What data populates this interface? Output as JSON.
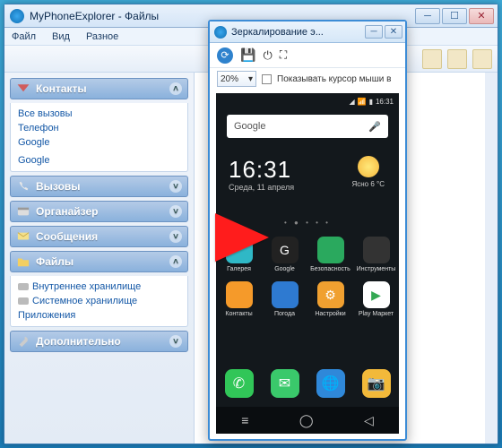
{
  "main": {
    "title": "MyPhoneExplorer -  Файлы",
    "menu": [
      "Файл",
      "Вид",
      "Разное"
    ]
  },
  "sidebar": {
    "contacts": {
      "title": "Контакты",
      "items": [
        "Все вызовы",
        "Телефон",
        "Google",
        " ",
        "Google"
      ]
    },
    "calls": {
      "title": "Вызовы"
    },
    "organizer": {
      "title": "Органайзер"
    },
    "messages": {
      "title": "Сообщения"
    },
    "files": {
      "title": "Файлы",
      "items": [
        "Внутреннее хранилище",
        "Системное хранилище",
        "Приложения"
      ]
    },
    "extra": {
      "title": "Дополнительно"
    }
  },
  "popup": {
    "title": "Зеркалирование э...",
    "zoom": "20%",
    "cursor_label": "Показывать курсор мыши в"
  },
  "phone": {
    "status_time": "16:31",
    "search_placeholder": "Google",
    "clock": "16:31",
    "date": "Среда, 11 апреля",
    "weather_temp": "6 °C",
    "weather_cond": "Ясно",
    "apps_row1": [
      {
        "label": "Галерея",
        "bg": "#2fb8c6"
      },
      {
        "label": "Google",
        "bg": "#222",
        "glyph": "G"
      },
      {
        "label": "Безопасность",
        "bg": "#2aa95e"
      },
      {
        "label": "Инструменты",
        "bg": "#333"
      }
    ],
    "apps_row2": [
      {
        "label": "Контакты",
        "bg": "#f59a2a"
      },
      {
        "label": "Погода",
        "bg": "#2e7ad1"
      },
      {
        "label": "Настройки",
        "bg": "#f0a030",
        "glyph": "⚙"
      },
      {
        "label": "Play Маркет",
        "bg": "#fff",
        "glyph": "▶"
      }
    ],
    "dock": [
      {
        "bg": "#31c658",
        "glyph": "✆"
      },
      {
        "bg": "#3ac96b",
        "glyph": "✉"
      },
      {
        "bg": "#2f88d9",
        "glyph": "🌐"
      },
      {
        "bg": "#f2b93a",
        "glyph": "📷"
      }
    ]
  }
}
